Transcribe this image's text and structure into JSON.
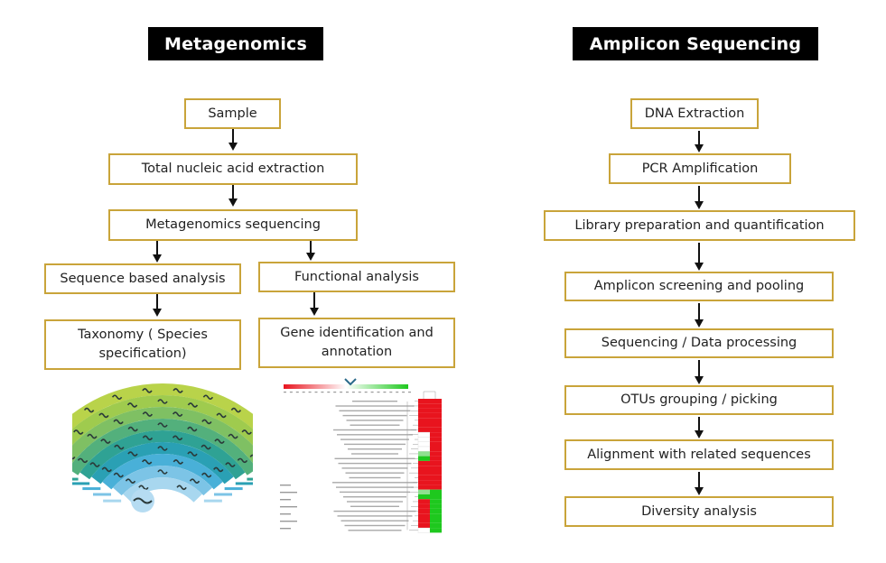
{
  "metagenomics": {
    "title": "Metagenomics",
    "steps": {
      "sample": "Sample",
      "extraction": "Total nucleic acid extraction",
      "sequencing": "Metagenomics sequencing",
      "sequence_analysis": "Sequence based analysis",
      "functional_analysis": "Functional analysis",
      "taxonomy": "Taxonomy ( Species specification)",
      "gene_identification": "Gene identification and annotation"
    },
    "taxonomy_illustration": {
      "description": "Taxonomic rank fan diagram",
      "level_colors": [
        "#b9d34a",
        "#9fcb4e",
        "#7fc063",
        "#53b07c",
        "#2fa294",
        "#2aa0b4",
        "#49b0d8",
        "#7cc4e6",
        "#a8d7ef"
      ]
    },
    "heatmap_illustration": {
      "description": "Gene annotation heatmap with color scale",
      "scale_colors": {
        "low": "#e8141e",
        "mid": "#ffffff",
        "high": "#1ec81e"
      },
      "columns": 2,
      "cells": [
        [
          "r",
          "r"
        ],
        [
          "r",
          "r"
        ],
        [
          "r",
          "r"
        ],
        [
          "r",
          "r"
        ],
        [
          "r",
          "r"
        ],
        [
          "r",
          "r"
        ],
        [
          "r",
          "r"
        ],
        [
          "w",
          "r"
        ],
        [
          "w",
          "r"
        ],
        [
          "w",
          "r"
        ],
        [
          "w",
          "r"
        ],
        [
          "lg",
          "r"
        ],
        [
          "g",
          "r"
        ],
        [
          "r",
          "r"
        ],
        [
          "r",
          "r"
        ],
        [
          "r",
          "r"
        ],
        [
          "r",
          "r"
        ],
        [
          "r",
          "r"
        ],
        [
          "r",
          "r"
        ],
        [
          "lg",
          "g"
        ],
        [
          "g",
          "g"
        ],
        [
          "r",
          "g"
        ],
        [
          "r",
          "g"
        ],
        [
          "r",
          "g"
        ],
        [
          "r",
          "g"
        ],
        [
          "r",
          "g"
        ],
        [
          "r",
          "g"
        ],
        [
          "w",
          "g"
        ]
      ]
    }
  },
  "amplicon": {
    "title": "Amplicon Sequencing",
    "steps": [
      "DNA Extraction",
      "PCR Amplification",
      "Library preparation and quantification",
      "Amplicon screening and pooling",
      "Sequencing / Data processing",
      "OTUs grouping / picking",
      "Alignment with related sequences",
      "Diversity analysis"
    ]
  },
  "colors": {
    "box_border": "#c9a43a",
    "title_bg": "#000000",
    "title_text": "#ffffff"
  }
}
